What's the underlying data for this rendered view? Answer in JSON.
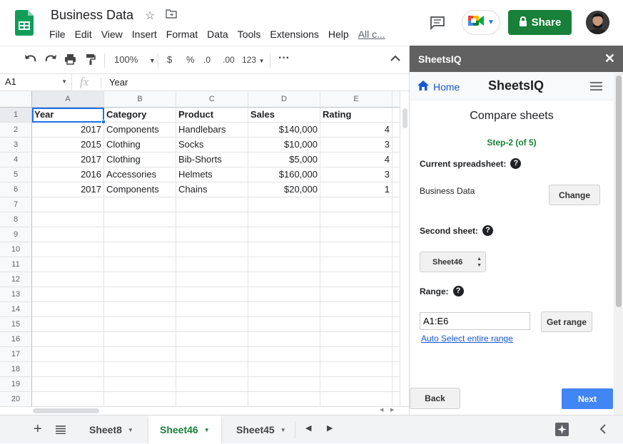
{
  "header": {
    "doc_title": "Business Data",
    "menus": [
      "File",
      "Edit",
      "View",
      "Insert",
      "Format",
      "Data",
      "Tools",
      "Extensions",
      "Help",
      "All c..."
    ],
    "share_label": "Share",
    "brand_green": "#188038"
  },
  "toolbar": {
    "zoom": "100%",
    "currency": "$",
    "percent": "%",
    "dec_decrease": ".0",
    "dec_increase": ".00",
    "format_123": "123"
  },
  "formula_bar": {
    "cell_ref": "A1",
    "fx": "fx",
    "value": "Year"
  },
  "grid": {
    "columns": [
      "A",
      "B",
      "C",
      "D",
      "E"
    ],
    "row_numbers": [
      "1",
      "2",
      "3",
      "4",
      "5",
      "6",
      "7",
      "8",
      "9",
      "10",
      "11",
      "12",
      "13",
      "14",
      "15",
      "16",
      "17",
      "18",
      "19",
      "20"
    ],
    "header_row": [
      "Year",
      "Category",
      "Product",
      "Sales",
      "Rating"
    ],
    "rows": [
      [
        "2017",
        "Components",
        "Handlebars",
        "$140,000",
        "4"
      ],
      [
        "2015",
        "Clothing",
        "Socks",
        "$10,000",
        "3"
      ],
      [
        "2017",
        "Clothing",
        "Bib-Shorts",
        "$5,000",
        "4"
      ],
      [
        "2016",
        "Accessories",
        "Helmets",
        "$160,000",
        "3"
      ],
      [
        "2017",
        "Components",
        "Chains",
        "$20,000",
        "1"
      ]
    ]
  },
  "sheets": {
    "tabs": [
      "Sheet8",
      "Sheet46",
      "Sheet45"
    ],
    "active": "Sheet46"
  },
  "sidebar": {
    "title": "SheetsIQ",
    "home_label": "Home",
    "brand": "SheetsIQ",
    "heading": "Compare sheets",
    "step": "Step-2 (of 5)",
    "current_label": "Current spreadsheet:",
    "current_value": "Business Data",
    "change_label": "Change",
    "second_label": "Second sheet:",
    "second_value": "Sheet46",
    "range_label": "Range:",
    "range_value": "A1:E6",
    "get_range_label": "Get range",
    "auto_select_label": "Auto Select entire range",
    "back_label": "Back",
    "next_label": "Next",
    "step_color": "#188038",
    "next_color": "#4285f4"
  }
}
